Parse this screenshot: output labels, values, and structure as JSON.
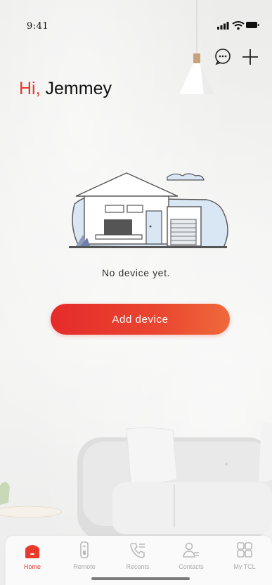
{
  "status_bar": {
    "time": "9:41"
  },
  "header": {
    "greeting_prefix": "Hi,",
    "user_name": "Jemmey"
  },
  "empty_state": {
    "message": "No device yet.",
    "add_button_label": "Add device"
  },
  "tabbar": {
    "items": [
      {
        "label": "Home",
        "icon": "home-icon",
        "active": true
      },
      {
        "label": "Remote",
        "icon": "remote-icon",
        "active": false
      },
      {
        "label": "Recents",
        "icon": "recents-icon",
        "active": false
      },
      {
        "label": "Contacts",
        "icon": "contacts-icon",
        "active": false
      },
      {
        "label": "My TCL",
        "icon": "grid-icon",
        "active": false
      }
    ]
  },
  "colors": {
    "accent": "#e8392a",
    "inactive": "#a9a9a9"
  }
}
